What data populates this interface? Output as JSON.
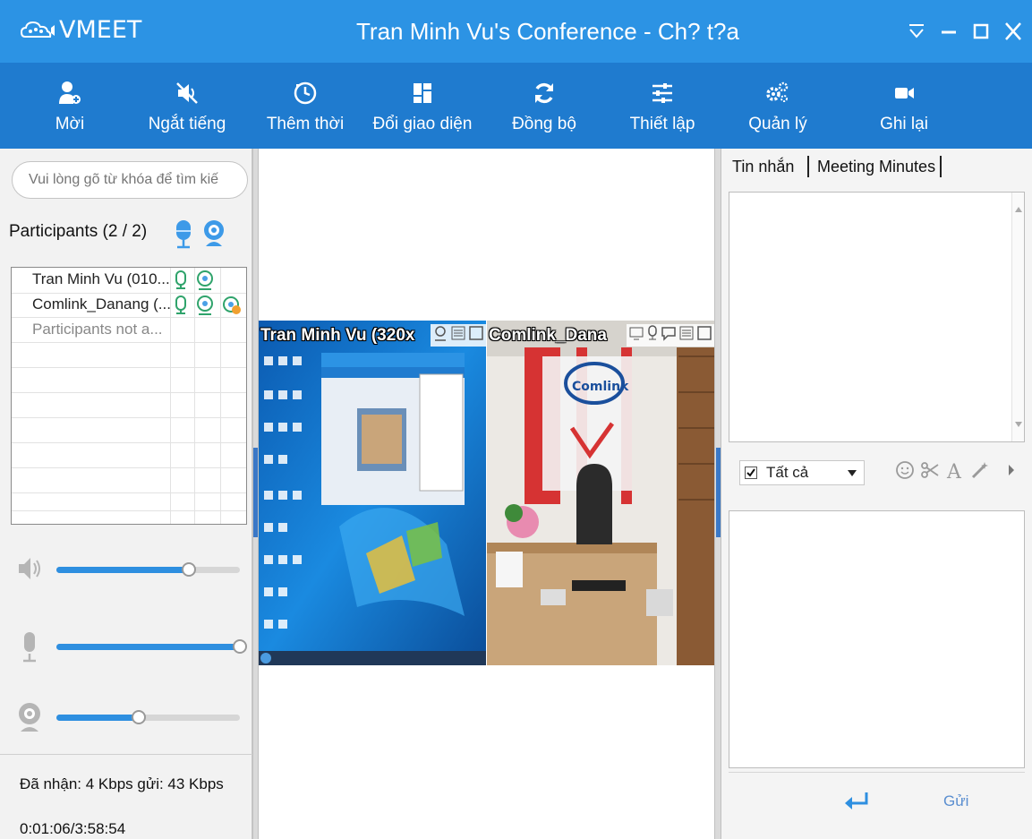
{
  "app": {
    "logo_text": "VMEET",
    "window_title": "Tran Minh Vu's Conference - Ch? t?a"
  },
  "window_controls": [
    "collapse",
    "minimize",
    "maximize",
    "close"
  ],
  "toolbar": {
    "items": [
      {
        "label": "Mời",
        "icon": "invite-user-icon"
      },
      {
        "label": "Ngắt tiếng",
        "icon": "mute-icon"
      },
      {
        "label": "Thêm thời",
        "icon": "clock-icon"
      },
      {
        "label": "Đổi giao diện",
        "icon": "layout-icon"
      },
      {
        "label": "Đồng bộ",
        "icon": "sync-icon"
      },
      {
        "label": "Thiết lập",
        "icon": "settings-sliders-icon"
      },
      {
        "label": "Quản lý",
        "icon": "gears-icon"
      },
      {
        "label": "Ghi lại",
        "icon": "record-video-icon"
      }
    ]
  },
  "left_panel": {
    "search_placeholder": "Vui lòng gõ từ khóa để tìm kiế",
    "participants_header": "Participants (2 / 2)",
    "participants": [
      {
        "name": "Tran Minh Vu (010..."
      },
      {
        "name": "Comlink_Danang (..."
      },
      {
        "name": "Participants not a..."
      }
    ],
    "volume": {
      "speaker": 0.72,
      "microphone": 1.0,
      "camera": 0.45
    },
    "stats": "Đã nhận: 4 Kbps gửi: 43 Kbps",
    "timer": "0:01:06/3:58:54"
  },
  "videos": [
    {
      "label": "Tran Minh Vu (320x"
    },
    {
      "label": "Comlink_Dana"
    }
  ],
  "right_panel": {
    "tabs": [
      "Tin nhắn",
      "Meeting Minutes"
    ],
    "recipient": "Tất cả",
    "send_label": "Gửi"
  },
  "colors": {
    "titlebar": "#2c93e4",
    "toolbar": "#1f7bcf",
    "accent": "#2e8fe0"
  }
}
